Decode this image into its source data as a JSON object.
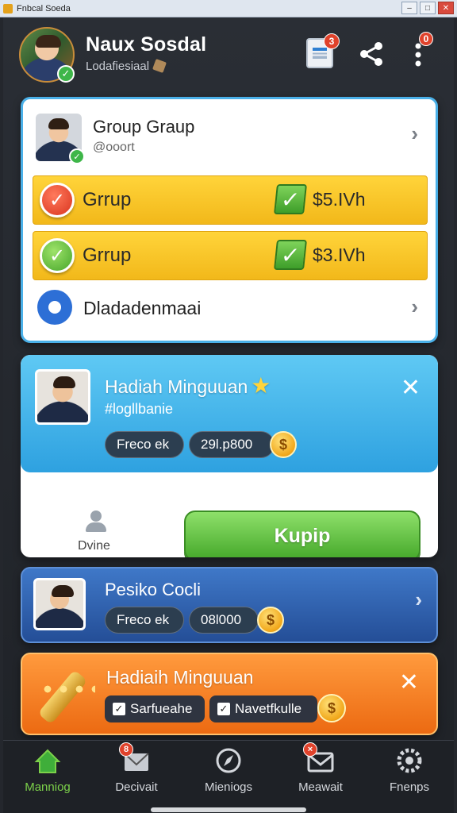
{
  "window": {
    "title": "Fnbcal Soeda",
    "buttons": [
      "–",
      "□",
      "✕"
    ]
  },
  "header": {
    "title": "Naux Sosdal",
    "subtitle": "Lodafiesiaal",
    "notif_badge": "3",
    "more_badge": "0"
  },
  "group_card": {
    "title": "Group Graup",
    "handle": "@ooort",
    "rows": [
      {
        "label": "Grrup",
        "price": "$5.IVh",
        "status": "red"
      },
      {
        "label": "Grrup",
        "price": "$3.IVh",
        "status": "green"
      }
    ],
    "settings_label": "Dladadenmaai"
  },
  "reward_card": {
    "title": "Hadiah Minguuan",
    "tag": "#logllbanie",
    "pill1": "Freco ek",
    "pill2": "29l.p800",
    "coin_symbol": "$",
    "person_label": "Dvine",
    "button_label": "Kupip"
  },
  "profile_card": {
    "title": "Pesiko Cocli",
    "pill1": "Freco ek",
    "pill2": "08l000",
    "coin_symbol": "$"
  },
  "weekly_card": {
    "title": "Hadiaih Minguuan",
    "check1": "Sarfueahe",
    "check2": "Navetfkulle",
    "coin_symbol": "$"
  },
  "nav": [
    {
      "label": "Manniog",
      "icon": "home-icon",
      "active": true
    },
    {
      "label": "Decivait",
      "icon": "inbox-icon",
      "badge": "8"
    },
    {
      "label": "Mieniogs",
      "icon": "compass-icon"
    },
    {
      "label": "Meawait",
      "icon": "mail-icon",
      "badge": "×"
    },
    {
      "label": "Fnenps",
      "icon": "gear-icon"
    }
  ],
  "colors": {
    "accent_blue": "#2ea1e0",
    "accent_green": "#45a82a",
    "accent_orange": "#ec6a12",
    "accent_yellow": "#ffd43a"
  }
}
